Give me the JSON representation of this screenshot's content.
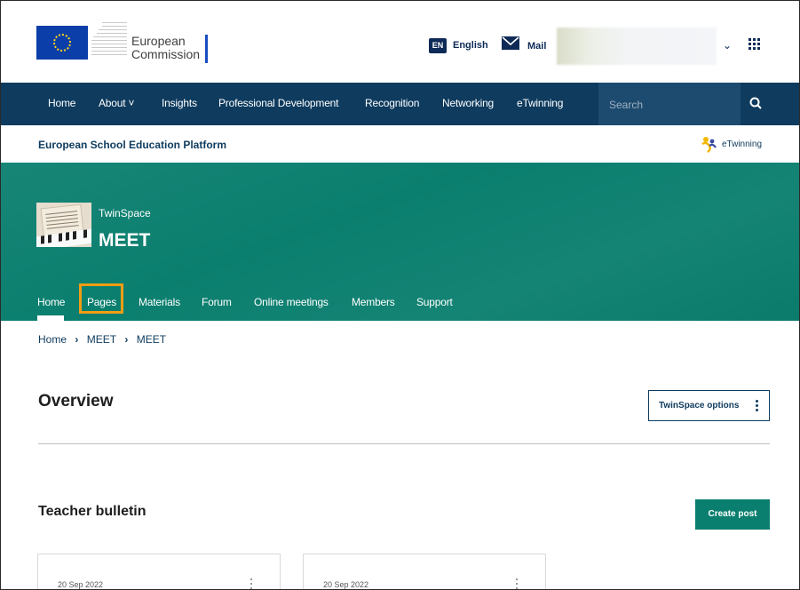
{
  "header": {
    "logo_line1": "European",
    "logo_line2": "Commission",
    "lang_code": "EN",
    "lang_label": "English",
    "mail_label": "Mail"
  },
  "nav": {
    "items": [
      "Home",
      "About",
      "Insights",
      "Professional Development",
      "Recognition",
      "Networking",
      "eTwinning"
    ],
    "search_placeholder": "Search"
  },
  "platform": {
    "title": "European School Education Platform",
    "etwinning_logo_text": "eTwinning"
  },
  "project": {
    "section_label": "TwinSpace",
    "title": "MEET",
    "tabs": [
      "Home",
      "Pages",
      "Materials",
      "Forum",
      "Online meetings",
      "Members",
      "Support"
    ],
    "active_tab": "Home",
    "highlighted_tab": "Pages"
  },
  "breadcrumb": [
    "Home",
    "MEET",
    "MEET"
  ],
  "overview": {
    "title": "Overview",
    "options_button": "TwinSpace options"
  },
  "bulletin": {
    "title": "Teacher bulletin",
    "create_button": "Create post",
    "posts": [
      {
        "date": "20 Sep 2022"
      },
      {
        "date": "20 Sep 2022"
      }
    ]
  },
  "colors": {
    "nav_bg": "#0e3b5e",
    "hero_bg": "#0b7f6f",
    "highlight": "#f29d12",
    "primary_button": "#0b7f6f"
  }
}
